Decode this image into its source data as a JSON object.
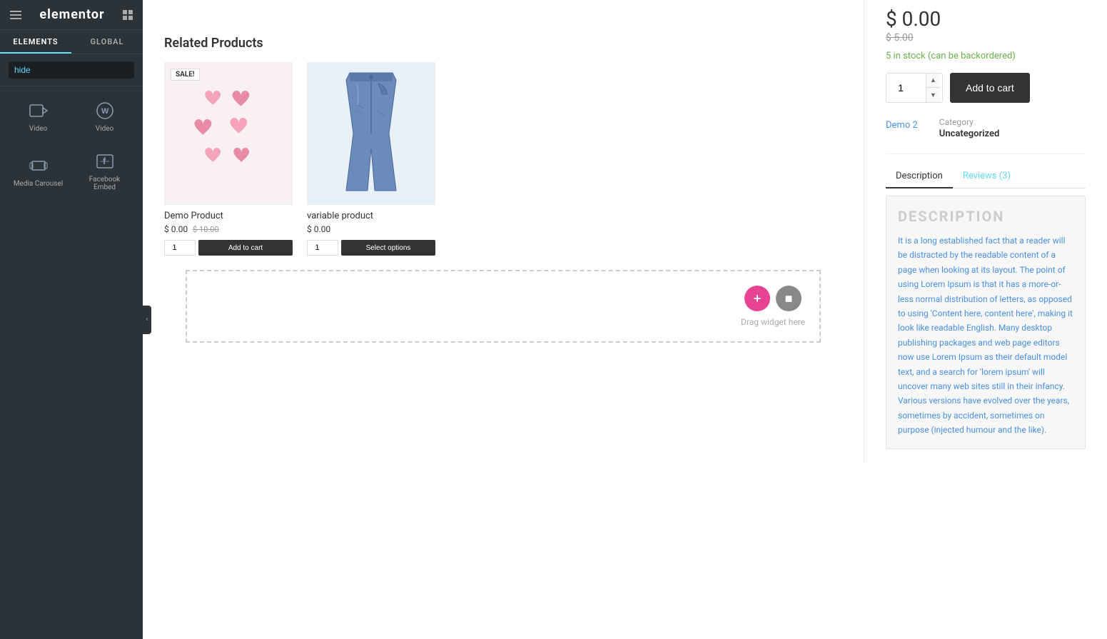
{
  "sidebar": {
    "brand": "elementor",
    "tabs": [
      {
        "id": "elements",
        "label": "ELEMENTS",
        "active": true
      },
      {
        "id": "global",
        "label": "GLOBAL",
        "active": false
      }
    ],
    "search_placeholder": "hide",
    "search_value": "hide",
    "widgets": [
      {
        "id": "video-1",
        "label": "Video",
        "icon": "video"
      },
      {
        "id": "video-2",
        "label": "Video",
        "icon": "wp-video"
      },
      {
        "id": "media-carousel",
        "label": "Media Carousel",
        "icon": "media-carousel"
      },
      {
        "id": "facebook-embed",
        "label": "Facebook Embed",
        "icon": "facebook-embed"
      }
    ]
  },
  "product": {
    "price_current": "$ 0.00",
    "price_original": "$ 5.00",
    "stock": "5 in stock (can be backordered)",
    "qty_value": "1",
    "add_to_cart_label": "Add to cart",
    "tag_label": "Demo 2",
    "category_label": "Category",
    "category_value": "Uncategorized"
  },
  "tabs": {
    "description_label": "Description",
    "reviews_label": "Reviews (3)"
  },
  "description": {
    "heading": "DESCRIPTION",
    "text": "It is a long established fact that a reader will be distracted by the readable content of a page when looking at its layout. The point of using Lorem Ipsum is that it has a more-or-less normal distribution of letters, as opposed to using 'Content here, content here', making it look like readable English. Many desktop publishing packages and web page editors now use Lorem Ipsum as their default model text, and a search for 'lorem ipsum' will uncover many web sites still in their infancy. Various versions have evolved over the years, sometimes by accident, sometimes on purpose (injected humour and the like)."
  },
  "related": {
    "heading": "Related Products",
    "products": [
      {
        "id": "demo-product",
        "name": "Demo Product",
        "price": "$ 0.00",
        "original_price": "$ 10.00",
        "badge": "SALE!",
        "type": "hearts"
      },
      {
        "id": "variable-product",
        "name": "variable product",
        "price": "$ 0.00",
        "original_price": "",
        "badge": "",
        "type": "jeans"
      }
    ]
  },
  "drag_area": {
    "label": "Drag widget here"
  }
}
